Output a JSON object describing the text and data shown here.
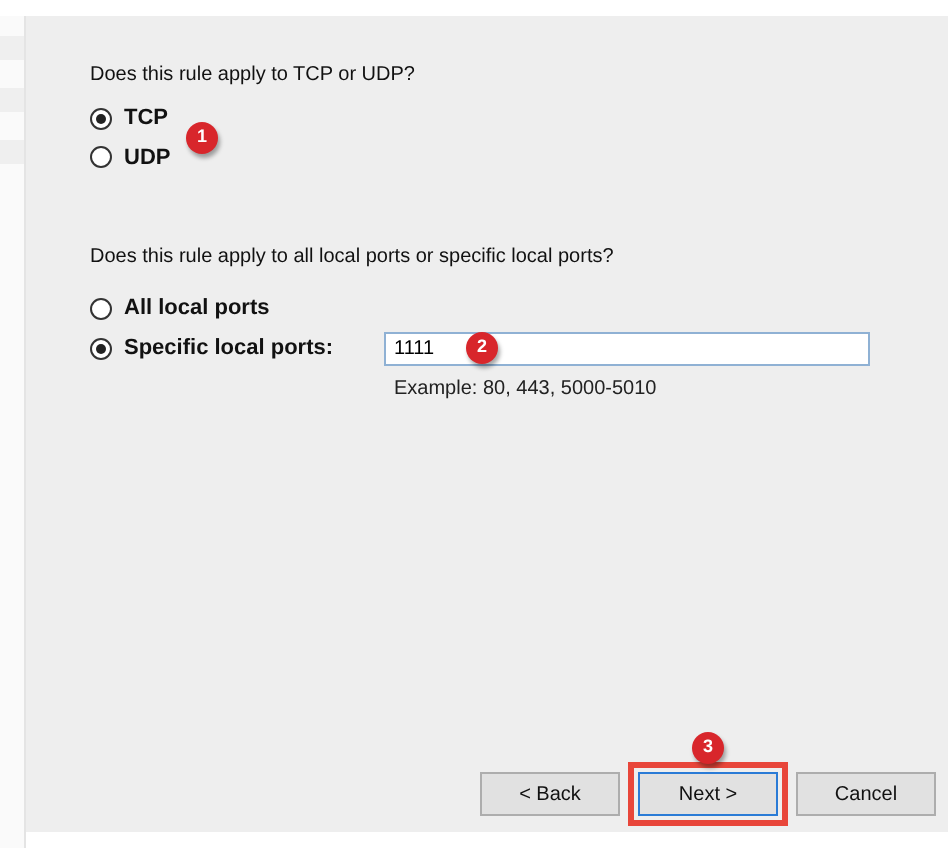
{
  "protocol": {
    "question": "Does this rule apply to TCP or UDP?",
    "options": [
      {
        "label": "TCP",
        "selected": true
      },
      {
        "label": "UDP",
        "selected": false
      }
    ]
  },
  "ports": {
    "question": "Does this rule apply to all local ports or specific local ports?",
    "options": [
      {
        "label": "All local ports",
        "selected": false
      },
      {
        "label": "Specific local ports:",
        "selected": true
      }
    ],
    "field": {
      "value": "1111"
    },
    "hint": "Example: 80, 443, 5000-5010"
  },
  "buttons": [
    {
      "label": "< Back",
      "highlighted": false
    },
    {
      "label": "Next >",
      "highlighted": true
    },
    {
      "label": "Cancel",
      "highlighted": false
    }
  ],
  "step_markers": [
    "1",
    "2",
    "3"
  ]
}
